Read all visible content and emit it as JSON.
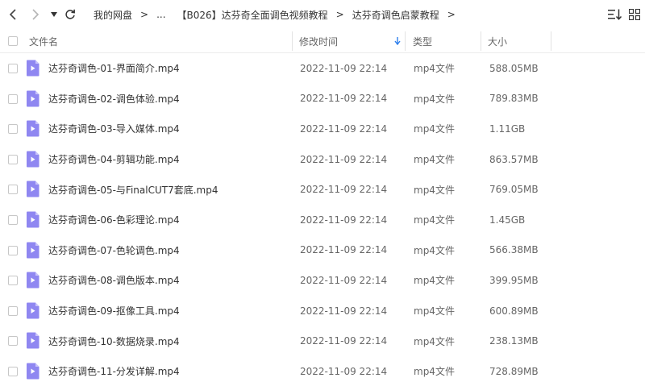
{
  "toolbar": {
    "back_icon": "chevron-left-icon",
    "forward_icon": "chevron-right-icon",
    "history_icon": "caret-down-icon",
    "refresh_icon": "refresh-icon",
    "breadcrumbs": [
      "我的网盘",
      "...",
      "【B026】达芬奇全面调色视频教程",
      "达芬奇调色启蒙教程"
    ],
    "separator": ">",
    "sort_icon": "sort-list-icon",
    "grid_icon": "grid-view-icon"
  },
  "header": {
    "name": "文件名",
    "time": "修改时间",
    "type": "类型",
    "size": "大小",
    "sort_indicator_color": "#2f80ed"
  },
  "colors": {
    "file_icon": "#8f87f1",
    "file_icon_fold": "#c9c4fa"
  },
  "files": [
    {
      "name": "达芬奇调色-01-界面简介.mp4",
      "time": "2022-11-09 22:14",
      "type": "mp4文件",
      "size": "588.05MB"
    },
    {
      "name": "达芬奇调色-02-调色体验.mp4",
      "time": "2022-11-09 22:14",
      "type": "mp4文件",
      "size": "789.83MB"
    },
    {
      "name": "达芬奇调色-03-导入媒体.mp4",
      "time": "2022-11-09 22:14",
      "type": "mp4文件",
      "size": "1.11GB"
    },
    {
      "name": "达芬奇调色-04-剪辑功能.mp4",
      "time": "2022-11-09 22:14",
      "type": "mp4文件",
      "size": "863.57MB"
    },
    {
      "name": "达芬奇调色-05-与FinalCUT7套底.mp4",
      "time": "2022-11-09 22:14",
      "type": "mp4文件",
      "size": "769.05MB"
    },
    {
      "name": "达芬奇调色-06-色彩理论.mp4",
      "time": "2022-11-09 22:14",
      "type": "mp4文件",
      "size": "1.45GB"
    },
    {
      "name": "达芬奇调色-07-色轮调色.mp4",
      "time": "2022-11-09 22:14",
      "type": "mp4文件",
      "size": "566.38MB"
    },
    {
      "name": "达芬奇调色-08-调色版本.mp4",
      "time": "2022-11-09 22:14",
      "type": "mp4文件",
      "size": "399.95MB"
    },
    {
      "name": "达芬奇调色-09-抠像工具.mp4",
      "time": "2022-11-09 22:14",
      "type": "mp4文件",
      "size": "600.89MB"
    },
    {
      "name": "达芬奇调色-10-数据烧录.mp4",
      "time": "2022-11-09 22:14",
      "type": "mp4文件",
      "size": "238.13MB"
    },
    {
      "name": "达芬奇调色-11-分发详解.mp4",
      "time": "2022-11-09 22:14",
      "type": "mp4文件",
      "size": "728.89MB"
    }
  ]
}
